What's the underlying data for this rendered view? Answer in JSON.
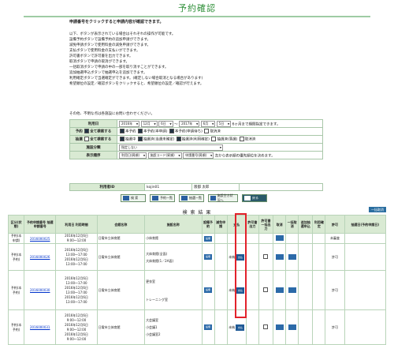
{
  "title": "予約確認",
  "intro": {
    "lead": "申請番号をクリックすると申請内容が確認できます。",
    "lines": [
      "以下、ボタンが表示されている場合はそれぞれの操作が可能です。",
      "設備予約ボタンで設備予約の追加申請ができます。",
      "減免申請ボタンで使用料金の減免申請ができます。",
      "支払ボタンで使用料金の支払いができます。",
      "許可書ボタンで許可書を出力できます。",
      "取消ボタンで申請の取消ができます。",
      "一括取消ボタンで申請の中の一部を取り消すことができます。",
      "追加抽選申込ボタンで抽選申込を追加できます。",
      "利用確定ボタンで当選確定ができます。(確定しない場合取消となる場合があります)",
      "希望順位の設定／確認ボタンをクリックすると、希望順位の設定／確認が行えます。"
    ],
    "contact": "その他、不明な点は各施設にお問い合わせください。"
  },
  "conditions": {
    "period_label": "利用日",
    "from": {
      "year": "2016年",
      "month": "12月",
      "day": "6日"
    },
    "tilde": "～",
    "to": {
      "year": "2017年",
      "month": "6月",
      "day": "5日"
    },
    "period_note": "6ヶ月まで期間指定できます。",
    "reserve_label": "予約",
    "reserve_checkall": "全て検索する",
    "reserve_opts": [
      "本予約",
      "本予約(本申請)",
      "本予約(申請待ち)",
      "取消済"
    ],
    "lottery_label": "抽選",
    "lottery_checkall": "全て検索する",
    "lottery_opts": [
      "抽選中",
      "抽選済(当選未確定)",
      "抽選済(利用確定)",
      "抽選済(落選)",
      "取消済"
    ],
    "facility_label": "施設分類",
    "facility_value": "指定しない",
    "order_label": "表示順序",
    "order_1": "利用日(昇順)",
    "order_2": "施設コード(昇順)",
    "order_3": "申請番号(昇順)",
    "order_note": "左から表示順の優先順位を決めます。"
  },
  "user": {
    "id_label": "利用者ID",
    "id_value": "kojin01",
    "name_label": "",
    "name_value": "阪都 太郎"
  },
  "buttons": [
    "検 索",
    "予約一覧",
    "抽選一覧",
    "施設空き状況へ",
    "戻る"
  ],
  "result": {
    "title": "検 索 結 果",
    "cancel_all": "一括取消",
    "headers": [
      "区分(状態)",
      "予約申請番号 抽選申請番号",
      "利用日 利用時間",
      "会館名称",
      "施設名称",
      "設備予約",
      "減免申請",
      "支払",
      "許可書出力",
      "許可書一括出力",
      "取消",
      "一括取消",
      "追加抽選申込",
      "利用確定",
      "許可",
      "抽選日(予約申請日)"
    ],
    "rows": [
      {
        "kubun": "予約(本申請)",
        "no": "2016000025",
        "dates": [
          "2016年12月6日",
          "9:00～12:00"
        ],
        "hall": "日電市立体育館",
        "fac": [
          "小体育館"
        ],
        "pay": "",
        "permit": "未審査"
      },
      {
        "kubun": "予約(本予約)",
        "no": "2016000026",
        "dates": [
          "2016年12月6日",
          "13:00～17:00",
          "2016年12月6日",
          "13:00～17:00"
        ],
        "hall": "日電市立体育館",
        "fac": [
          "大体育館(全面)",
          "大体育館(1／2A面)"
        ],
        "pay": "未納",
        "permit": "許可"
      },
      {
        "kubun": "予約(本予約)",
        "no": "2016000030",
        "dates": [
          "2016年12月6日",
          "13:00～17:00",
          "2016年12月6日",
          "13:00～17:00",
          "2016年12月6日",
          "13:00～17:00"
        ],
        "hall": "日電市立体育館",
        "fac": [
          "更衣室",
          "トレーニング室"
        ],
        "pay": "未納",
        "permit": "許可"
      },
      {
        "kubun": "予約(本予約)",
        "no": "2016000031",
        "dates": [
          "2016年12月6日",
          "9:00～12:00",
          "2016年12月6日",
          "9:00～12:00",
          "2016年12月6日",
          "9:00～12:00"
        ],
        "hall": "日電市立体育館",
        "fac": [
          "大会議室",
          "小会議1",
          "小会議室2"
        ],
        "pay": "未納",
        "permit": "許可"
      }
    ],
    "pay_button": "支払",
    "mini_button": "設備"
  }
}
